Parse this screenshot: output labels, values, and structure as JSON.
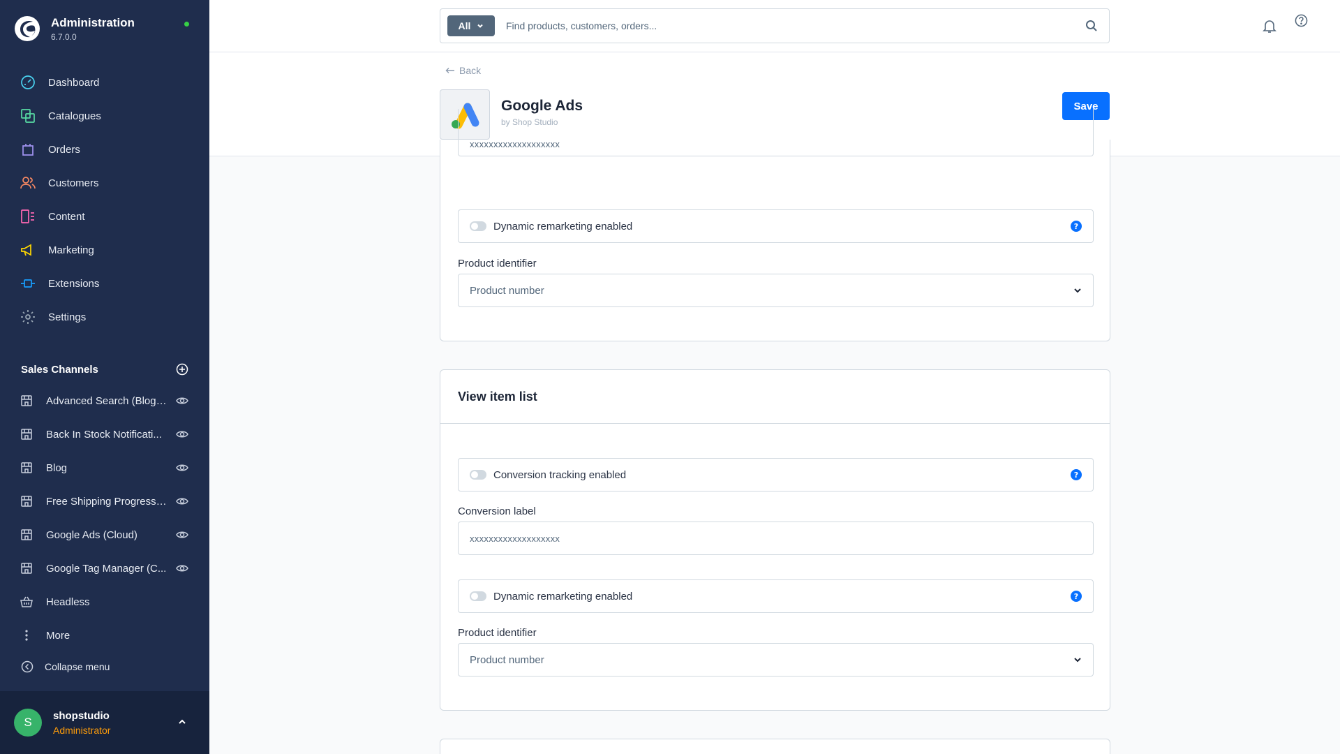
{
  "app": {
    "title": "Administration",
    "version": "6.7.0.0"
  },
  "nav": [
    {
      "label": "Dashboard",
      "icon": "dashboard-icon",
      "color": "#4ad3f0"
    },
    {
      "label": "Catalogues",
      "icon": "catalogue-icon",
      "color": "#57d9a3"
    },
    {
      "label": "Orders",
      "icon": "orders-icon",
      "color": "#a092f0"
    },
    {
      "label": "Customers",
      "icon": "customers-icon",
      "color": "#f88962"
    },
    {
      "label": "Content",
      "icon": "content-icon",
      "color": "#ff68b4"
    },
    {
      "label": "Marketing",
      "icon": "marketing-icon",
      "color": "#ffd700"
    },
    {
      "label": "Extensions",
      "icon": "extensions-icon",
      "color": "#189eff"
    },
    {
      "label": "Settings",
      "icon": "settings-icon",
      "color": "#9aa8b5"
    }
  ],
  "sales_channels": {
    "title": "Sales Channels",
    "items": [
      {
        "label": "Advanced Search (Blog ..."
      },
      {
        "label": "Back In Stock Notificati..."
      },
      {
        "label": "Blog"
      },
      {
        "label": "Free Shipping Progress ..."
      },
      {
        "label": "Google Ads (Cloud)"
      },
      {
        "label": "Google Tag Manager (C..."
      },
      {
        "label": "Headless"
      },
      {
        "label": "More"
      }
    ]
  },
  "collapse_label": "Collapse menu",
  "user": {
    "initial": "S",
    "name": "shopstudio",
    "role": "Administrator"
  },
  "search": {
    "type": "All",
    "placeholder": "Find products, customers, orders..."
  },
  "back_label": "Back",
  "plugin": {
    "name": "Google Ads",
    "author": "by Shop Studio"
  },
  "save_label": "Save",
  "card1": {
    "label_value": "xxxxxxxxxxxxxxxxxxx",
    "remarketing_label": "Dynamic remarketing enabled",
    "identifier_label": "Product identifier",
    "identifier_value": "Product number"
  },
  "card2": {
    "title": "View item list",
    "tracking_label": "Conversion tracking enabled",
    "conversion_label": "Conversion label",
    "conversion_value": "xxxxxxxxxxxxxxxxxxx",
    "remarketing_label": "Dynamic remarketing enabled",
    "identifier_label": "Product identifier",
    "identifier_value": "Product number"
  }
}
